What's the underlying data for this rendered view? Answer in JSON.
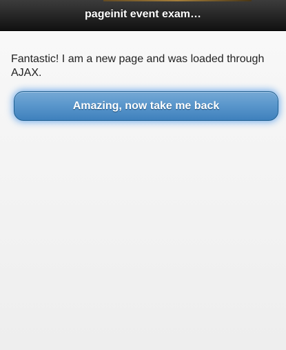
{
  "header": {
    "title": "pageinit event exam…"
  },
  "content": {
    "message": "Fantastic! I am a new page and was loaded through AJAX."
  },
  "button": {
    "back_label": "Amazing, now take me back"
  },
  "colors": {
    "header_bg": "#1b1b1b",
    "button_bg": "#5b97cc",
    "page_bg": "#f3f3f3"
  }
}
